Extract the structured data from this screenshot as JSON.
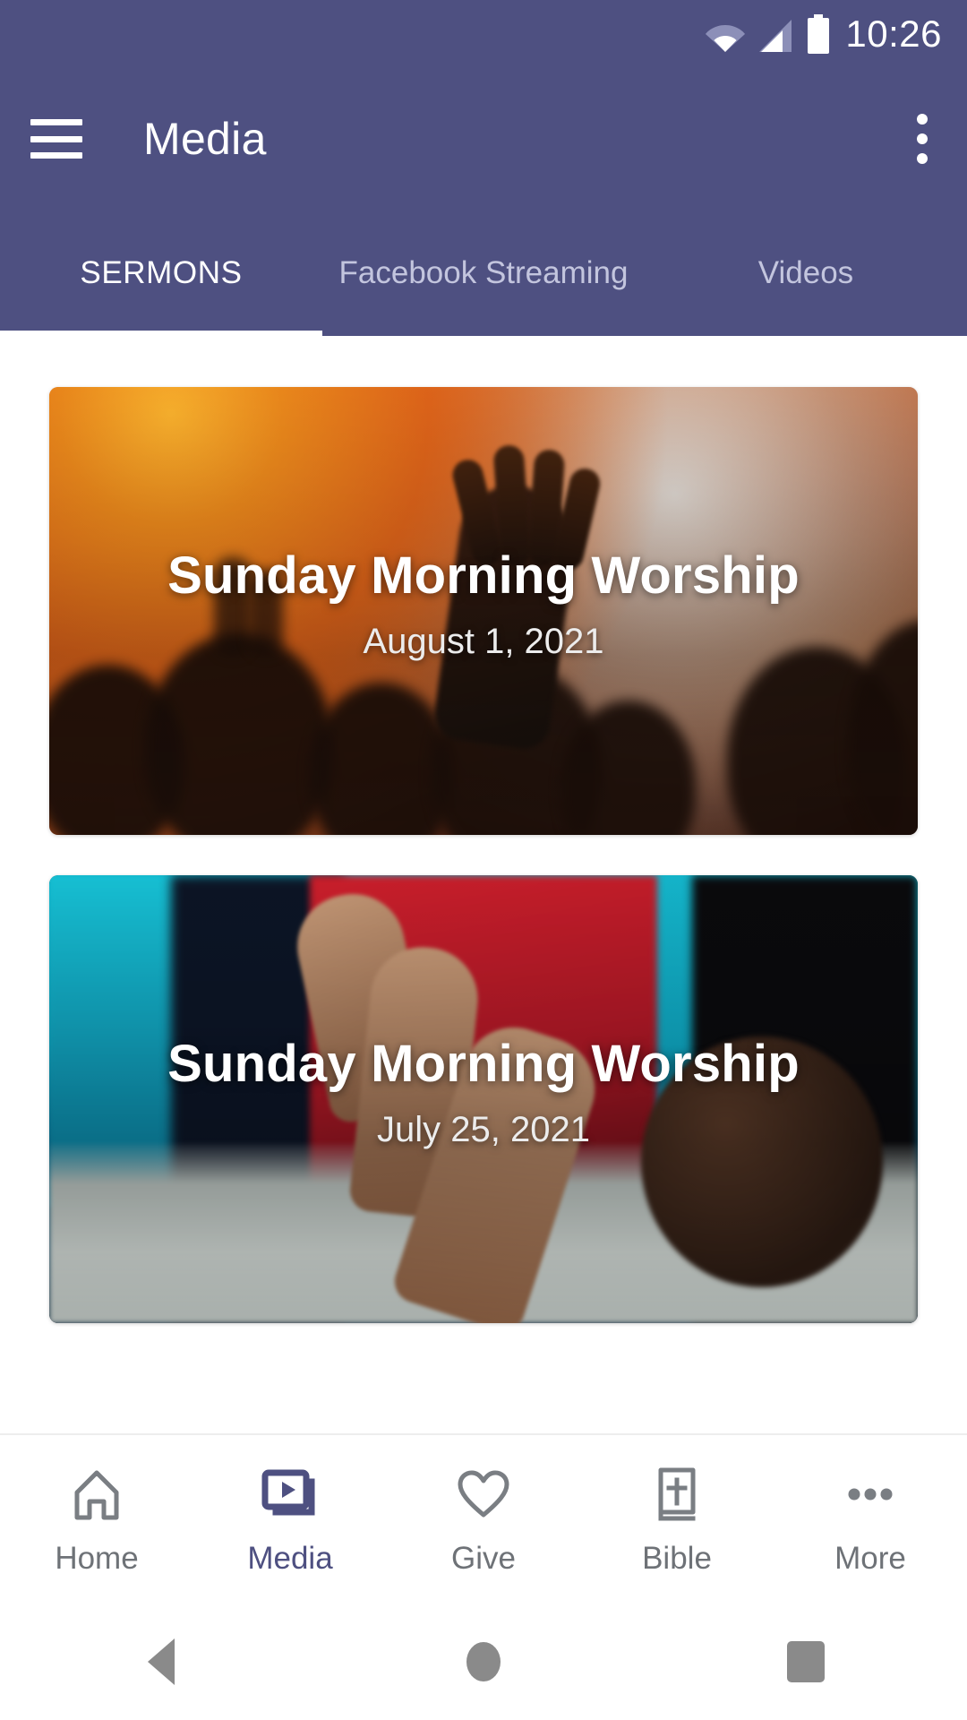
{
  "status_bar": {
    "time": "10:26",
    "icons": [
      "wifi-icon",
      "cellular-signal-icon",
      "battery-icon"
    ]
  },
  "app_bar": {
    "menu_icon": "hamburger-menu-icon",
    "title": "Media",
    "overflow_icon": "kebab-menu-icon",
    "background_color": "#4e5081"
  },
  "tabs": {
    "items": [
      {
        "label": "SERMONS",
        "active": true
      },
      {
        "label": "Facebook Streaming",
        "active": false
      },
      {
        "label": "Videos",
        "active": false
      }
    ],
    "active_indicator_color": "#ffffff",
    "inactive_text_color": "#c3c5de"
  },
  "sermons": [
    {
      "title": "Sunday Morning Worship",
      "date": "August 1, 2021"
    },
    {
      "title": "Sunday Morning Worship",
      "date": "July 25, 2021"
    }
  ],
  "bottom_nav": {
    "active_color": "#4e5081",
    "inactive_color": "#6e7277",
    "items": [
      {
        "label": "Home",
        "icon": "home-icon",
        "active": false
      },
      {
        "label": "Media",
        "icon": "media-play-icon",
        "active": true
      },
      {
        "label": "Give",
        "icon": "heart-icon",
        "active": false
      },
      {
        "label": "Bible",
        "icon": "bible-book-icon",
        "active": false
      },
      {
        "label": "More",
        "icon": "ellipsis-icon",
        "active": false
      }
    ]
  },
  "system_nav": {
    "back": "back-triangle-icon",
    "home": "home-circle-icon",
    "recents": "recents-square-icon"
  }
}
